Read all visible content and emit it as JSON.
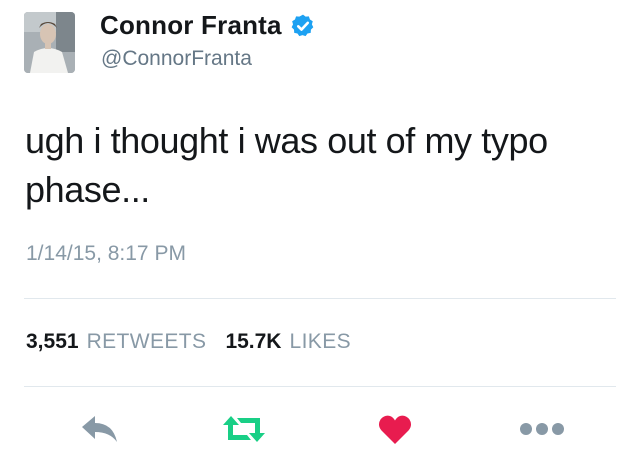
{
  "tweet": {
    "author": {
      "display_name": "Connor Franta",
      "handle": "@ConnorFranta",
      "verified": true
    },
    "text_line1": "ugh i thought i was out of my typo",
    "text_line2": "phase...",
    "timestamp": "1/14/15, 8:17 PM",
    "stats": {
      "retweets_count": "3,551",
      "retweets_label": "RETWEETS",
      "likes_count": "15.7K",
      "likes_label": "LIKES"
    },
    "actions": [
      "reply-icon",
      "retweet-icon",
      "heart-icon",
      "more-icon"
    ]
  },
  "colors": {
    "retweet": "#19cf86",
    "like": "#e81c4f",
    "icon_gray": "#8899a6",
    "verified": "#1da1f2"
  }
}
